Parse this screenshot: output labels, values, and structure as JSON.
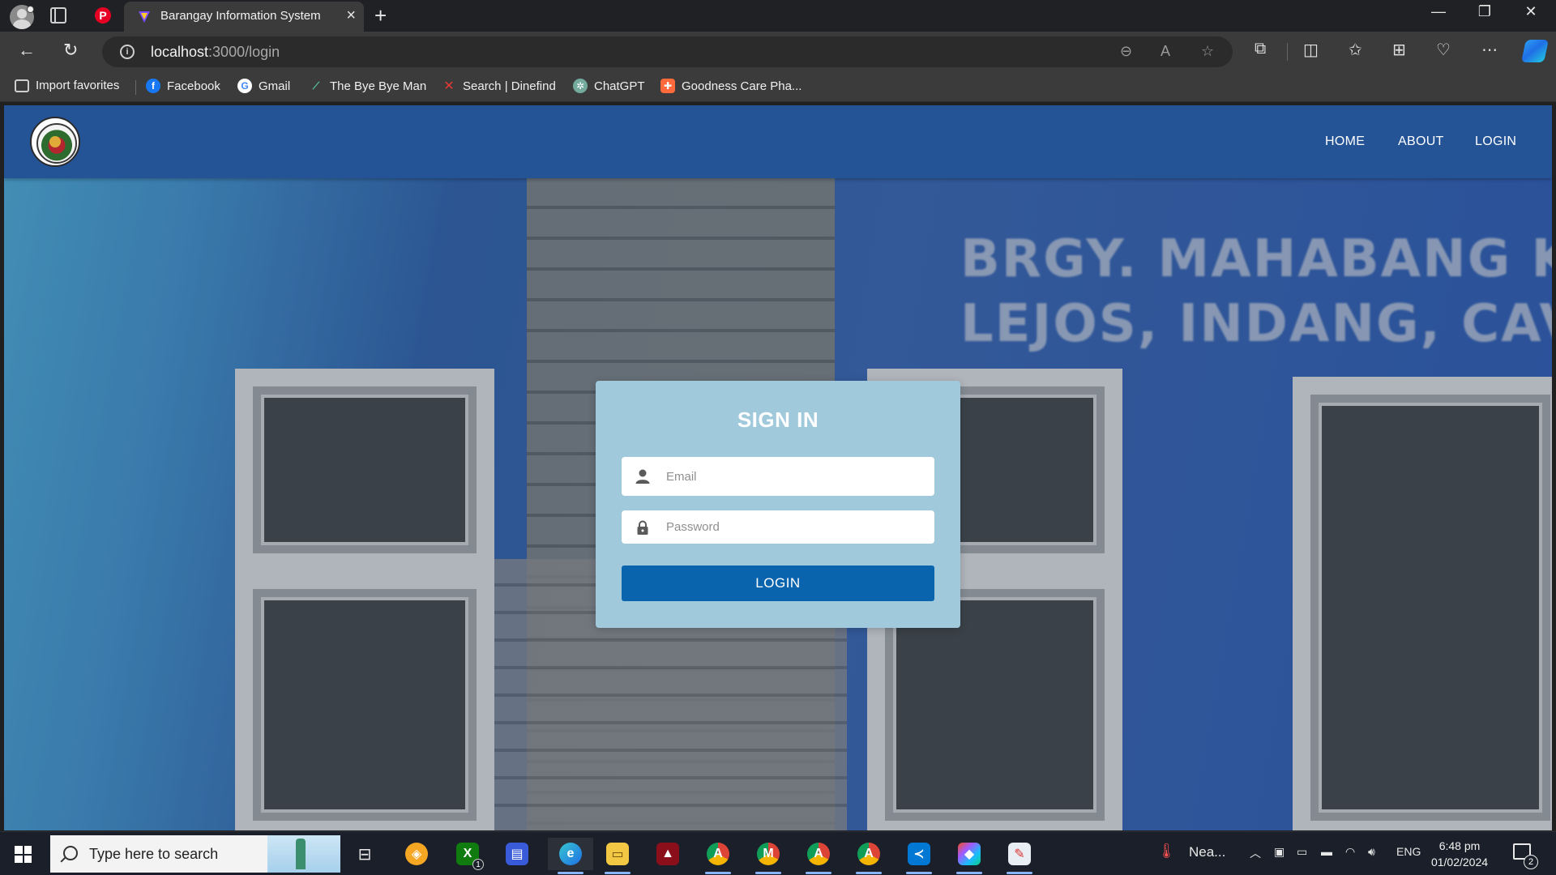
{
  "browser": {
    "tab": {
      "title": "Barangay Information System"
    },
    "address": {
      "host": "localhost",
      "path": ":3000/login"
    },
    "favorites": [
      {
        "label": "Import favorites",
        "icon": "import-favorites-icon"
      },
      {
        "label": "Facebook",
        "icon": "facebook-icon",
        "color": "#1877f2"
      },
      {
        "label": "Gmail",
        "icon": "google-icon",
        "color": "#ffffff"
      },
      {
        "label": "The Bye Bye Man",
        "icon": "bookmark-icon",
        "color": "#5ac8a0"
      },
      {
        "label": "Search | Dinefind",
        "icon": "dinefind-icon",
        "color": "#e53935"
      },
      {
        "label": "ChatGPT",
        "icon": "chatgpt-icon",
        "color": "#74aa9c"
      },
      {
        "label": "Goodness Care Pha...",
        "icon": "pharmacy-icon",
        "color": "#ff6a3d"
      }
    ]
  },
  "site": {
    "nav": {
      "home": "HOME",
      "about": "ABOUT",
      "login": "LOGIN"
    },
    "colors": {
      "navbar": "#245396",
      "card": "#a0c9dc",
      "button": "#0a63ad"
    }
  },
  "login": {
    "title": "SIGN IN",
    "email_placeholder": "Email",
    "password_placeholder": "Password",
    "button": "LOGIN"
  },
  "taskbar": {
    "search_placeholder": "Type here to search",
    "weather": "Nea...",
    "language": "ENG",
    "time": "6:48 pm",
    "date": "01/02/2024",
    "notifications": "2",
    "xbox_badge": "1"
  }
}
